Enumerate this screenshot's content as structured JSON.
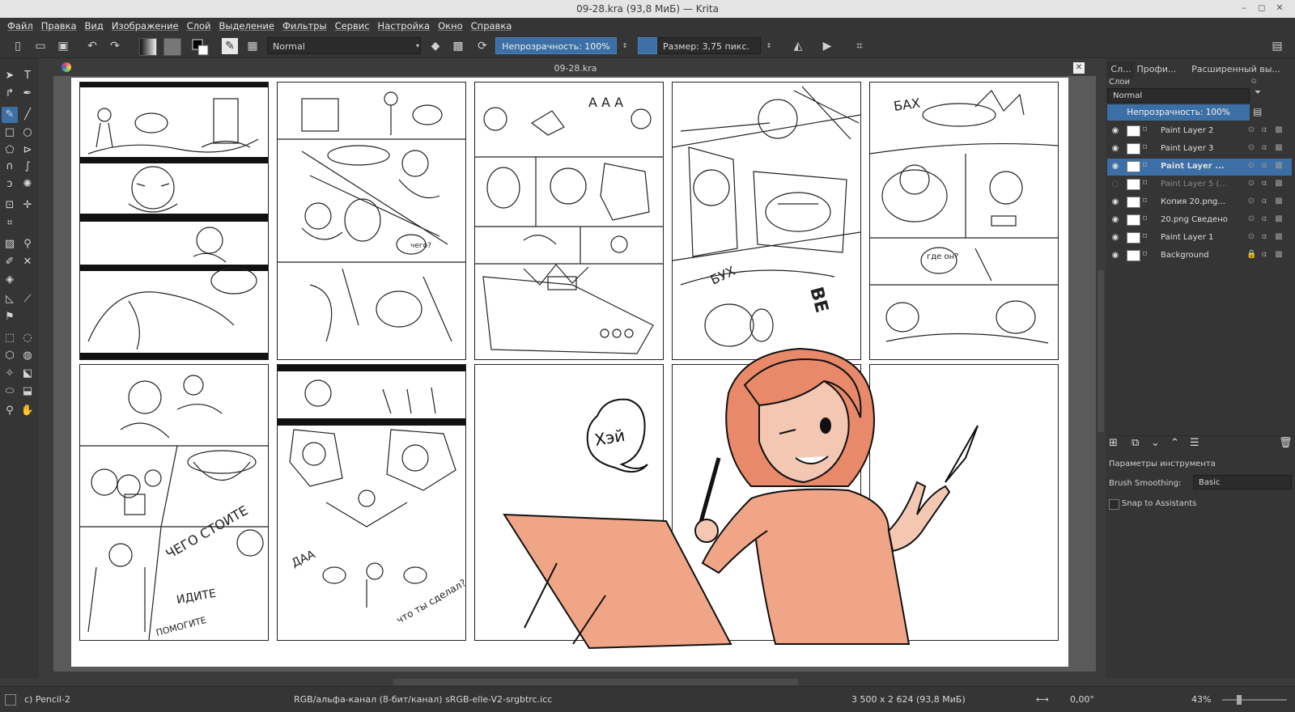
{
  "window": {
    "title": "09-28.kra (93,8 МиБ) — Krita"
  },
  "menu": [
    "Файл",
    "Правка",
    "Вид",
    "Изображение",
    "Слой",
    "Выделение",
    "Фильтры",
    "Сервис",
    "Настройка",
    "Окно",
    "Справка"
  ],
  "toolbar": {
    "blend_mode": "Normal",
    "opacity_label": "Непрозрачность: 100%",
    "size_label": "Размер: 3,75 пикс."
  },
  "document": {
    "tab_title": "09-28.kra"
  },
  "art": {
    "bubble_hey": "Хэй",
    "sfx_bakh": "БАХ",
    "sfx_bukh": "БУХ",
    "sfx_ba": "ВЕ",
    "sfx_aaa": "А А А",
    "sfx_aa2": "ДАА",
    "text_chego_stoite": "ЧЕГО СТОИТЕ",
    "text_idite": "ИДИТЕ",
    "text_pomogite": "ПОМОГИТЕ",
    "text_gde_on": "где он?",
    "text_chego": "чего?",
    "text_chto_ty_sdelal": "что ты сделал?"
  },
  "docker": {
    "tabs": [
      "Сл...",
      "Профи...",
      "Расширенный вы..."
    ],
    "section_title": "Слои",
    "blend_mode": "Normal",
    "opacity_label": "Непрозрачность:  100%",
    "layers": [
      {
        "name": "Paint Layer 2",
        "visible": true,
        "selected": false
      },
      {
        "name": "Paint Layer 3",
        "visible": true,
        "selected": false
      },
      {
        "name": "Paint Layer ...",
        "visible": true,
        "selected": true
      },
      {
        "name": "Paint Layer 5 (...",
        "visible": false,
        "selected": false
      },
      {
        "name": "Копия  20.png...",
        "visible": true,
        "selected": false
      },
      {
        "name": "20.png Сведено",
        "visible": true,
        "selected": false
      },
      {
        "name": "Paint Layer 1",
        "visible": true,
        "selected": false
      },
      {
        "name": "Background",
        "visible": true,
        "selected": false,
        "locked": true
      }
    ],
    "tool_options_title": "Параметры инструмента",
    "brush_smoothing_label": "Brush Smoothing:",
    "brush_smoothing_value": "Basic",
    "snap_label": "Snap to Assistants"
  },
  "status": {
    "brush": "c) Pencil-2",
    "color_model": "RGB/альфа-канал (8-бит/канал)  sRGB-elle-V2-srgbtrc.icc",
    "dimensions": "3 500 x 2 624 (93,8 МиБ)",
    "rotation": "0,00°",
    "zoom": "43%"
  },
  "colors": {
    "accent": "#3c6fa5",
    "panel": "#353535",
    "skin": "#f0a587"
  }
}
